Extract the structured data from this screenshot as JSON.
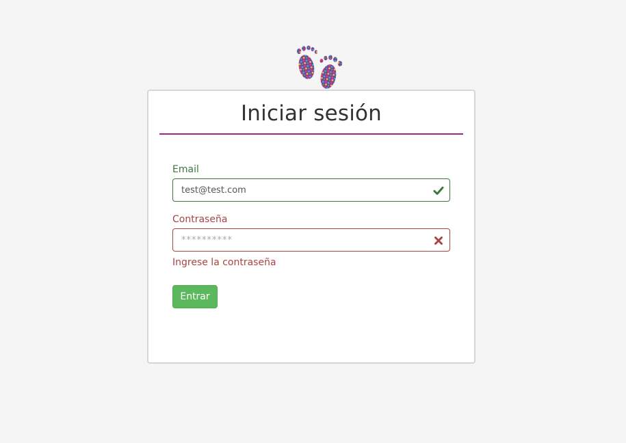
{
  "header": {
    "logo_icon": "footprints-icon"
  },
  "login": {
    "title": "Iniciar sesión",
    "accent_color": "#a6238f",
    "email": {
      "label": "Email",
      "value": "test@test.com",
      "state": "valid",
      "state_icon": "checkmark-icon",
      "color": "#3c763d"
    },
    "password": {
      "label": "Contraseña",
      "value": "",
      "placeholder": "**********",
      "state": "error",
      "state_icon": "cross-icon",
      "color": "#a94442",
      "error_message": "Ingrese la contraseña"
    },
    "submit_label": "Entrar",
    "submit_color": "#5cb85c"
  }
}
